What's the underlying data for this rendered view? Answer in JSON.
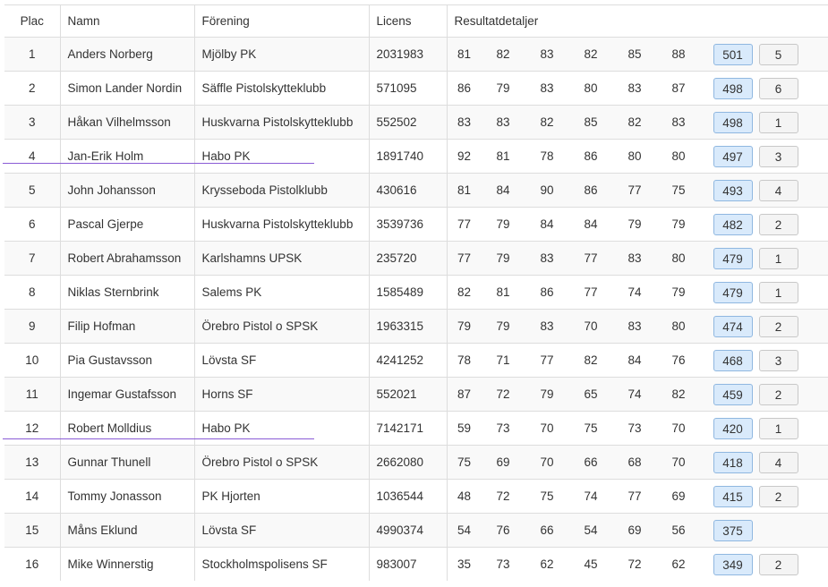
{
  "header": {
    "plac": "Plac",
    "namn": "Namn",
    "forening": "Förening",
    "licens": "Licens",
    "resultat": "Resultatdetaljer"
  },
  "colors": {
    "total_badge_bg": "#d9eafb",
    "total_badge_border": "#8fb7e0",
    "annotation_line": "#8a5bd6"
  },
  "rows": [
    {
      "plac": "1",
      "namn": "Anders Norberg",
      "forening": "Mjölby PK",
      "licens": "2031983",
      "scores": [
        "81",
        "82",
        "83",
        "82",
        "85",
        "88"
      ],
      "total": "501",
      "place_badge": "5"
    },
    {
      "plac": "2",
      "namn": "Simon Lander Nordin",
      "forening": "Säffle Pistolskytteklubb",
      "licens": "571095",
      "scores": [
        "86",
        "79",
        "83",
        "80",
        "83",
        "87"
      ],
      "total": "498",
      "place_badge": "6"
    },
    {
      "plac": "3",
      "namn": "Håkan Vilhelmsson",
      "forening": "Huskvarna Pistolskytteklubb",
      "licens": "552502",
      "scores": [
        "83",
        "83",
        "82",
        "85",
        "82",
        "83"
      ],
      "total": "498",
      "place_badge": "1"
    },
    {
      "plac": "4",
      "namn": "Jan-Erik Holm",
      "forening": "Habo PK",
      "licens": "1891740",
      "scores": [
        "92",
        "81",
        "78",
        "86",
        "80",
        "80"
      ],
      "total": "497",
      "place_badge": "3"
    },
    {
      "plac": "5",
      "namn": "John Johansson",
      "forening": "Krysseboda Pistolklubb",
      "licens": "430616",
      "scores": [
        "81",
        "84",
        "90",
        "86",
        "77",
        "75"
      ],
      "total": "493",
      "place_badge": "4"
    },
    {
      "plac": "6",
      "namn": "Pascal Gjerpe",
      "forening": "Huskvarna Pistolskytteklubb",
      "licens": "3539736",
      "scores": [
        "77",
        "79",
        "84",
        "84",
        "79",
        "79"
      ],
      "total": "482",
      "place_badge": "2"
    },
    {
      "plac": "7",
      "namn": "Robert Abrahamsson",
      "forening": "Karlshamns UPSK",
      "licens": "235720",
      "scores": [
        "77",
        "79",
        "83",
        "77",
        "83",
        "80"
      ],
      "total": "479",
      "place_badge": "1"
    },
    {
      "plac": "8",
      "namn": "Niklas Sternbrink",
      "forening": "Salems PK",
      "licens": "1585489",
      "scores": [
        "82",
        "81",
        "86",
        "77",
        "74",
        "79"
      ],
      "total": "479",
      "place_badge": "1"
    },
    {
      "plac": "9",
      "namn": "Filip Hofman",
      "forening": "Örebro Pistol o SPSK",
      "licens": "1963315",
      "scores": [
        "79",
        "79",
        "83",
        "70",
        "83",
        "80"
      ],
      "total": "474",
      "place_badge": "2"
    },
    {
      "plac": "10",
      "namn": "Pia Gustavsson",
      "forening": "Lövsta SF",
      "licens": "4241252",
      "scores": [
        "78",
        "71",
        "77",
        "82",
        "84",
        "76"
      ],
      "total": "468",
      "place_badge": "3"
    },
    {
      "plac": "11",
      "namn": "Ingemar Gustafsson",
      "forening": "Horns SF",
      "licens": "552021",
      "scores": [
        "87",
        "72",
        "79",
        "65",
        "74",
        "82"
      ],
      "total": "459",
      "place_badge": "2"
    },
    {
      "plac": "12",
      "namn": "Robert Molldius",
      "forening": "Habo PK",
      "licens": "7142171",
      "scores": [
        "59",
        "73",
        "70",
        "75",
        "73",
        "70"
      ],
      "total": "420",
      "place_badge": "1"
    },
    {
      "plac": "13",
      "namn": "Gunnar Thunell",
      "forening": "Örebro Pistol o SPSK",
      "licens": "2662080",
      "scores": [
        "75",
        "69",
        "70",
        "66",
        "68",
        "70"
      ],
      "total": "418",
      "place_badge": "4"
    },
    {
      "plac": "14",
      "namn": "Tommy Jonasson",
      "forening": "PK Hjorten",
      "licens": "1036544",
      "scores": [
        "48",
        "72",
        "75",
        "74",
        "77",
        "69"
      ],
      "total": "415",
      "place_badge": "2"
    },
    {
      "plac": "15",
      "namn": "Måns Eklund",
      "forening": "Lövsta SF",
      "licens": "4990374",
      "scores": [
        "54",
        "76",
        "66",
        "54",
        "69",
        "56"
      ],
      "total": "375",
      "place_badge": ""
    },
    {
      "plac": "16",
      "namn": "Mike Winnerstig",
      "forening": "Stockholmspolisens SF",
      "licens": "983007",
      "scores": [
        "35",
        "73",
        "62",
        "45",
        "72",
        "62"
      ],
      "total": "349",
      "place_badge": "2"
    }
  ]
}
